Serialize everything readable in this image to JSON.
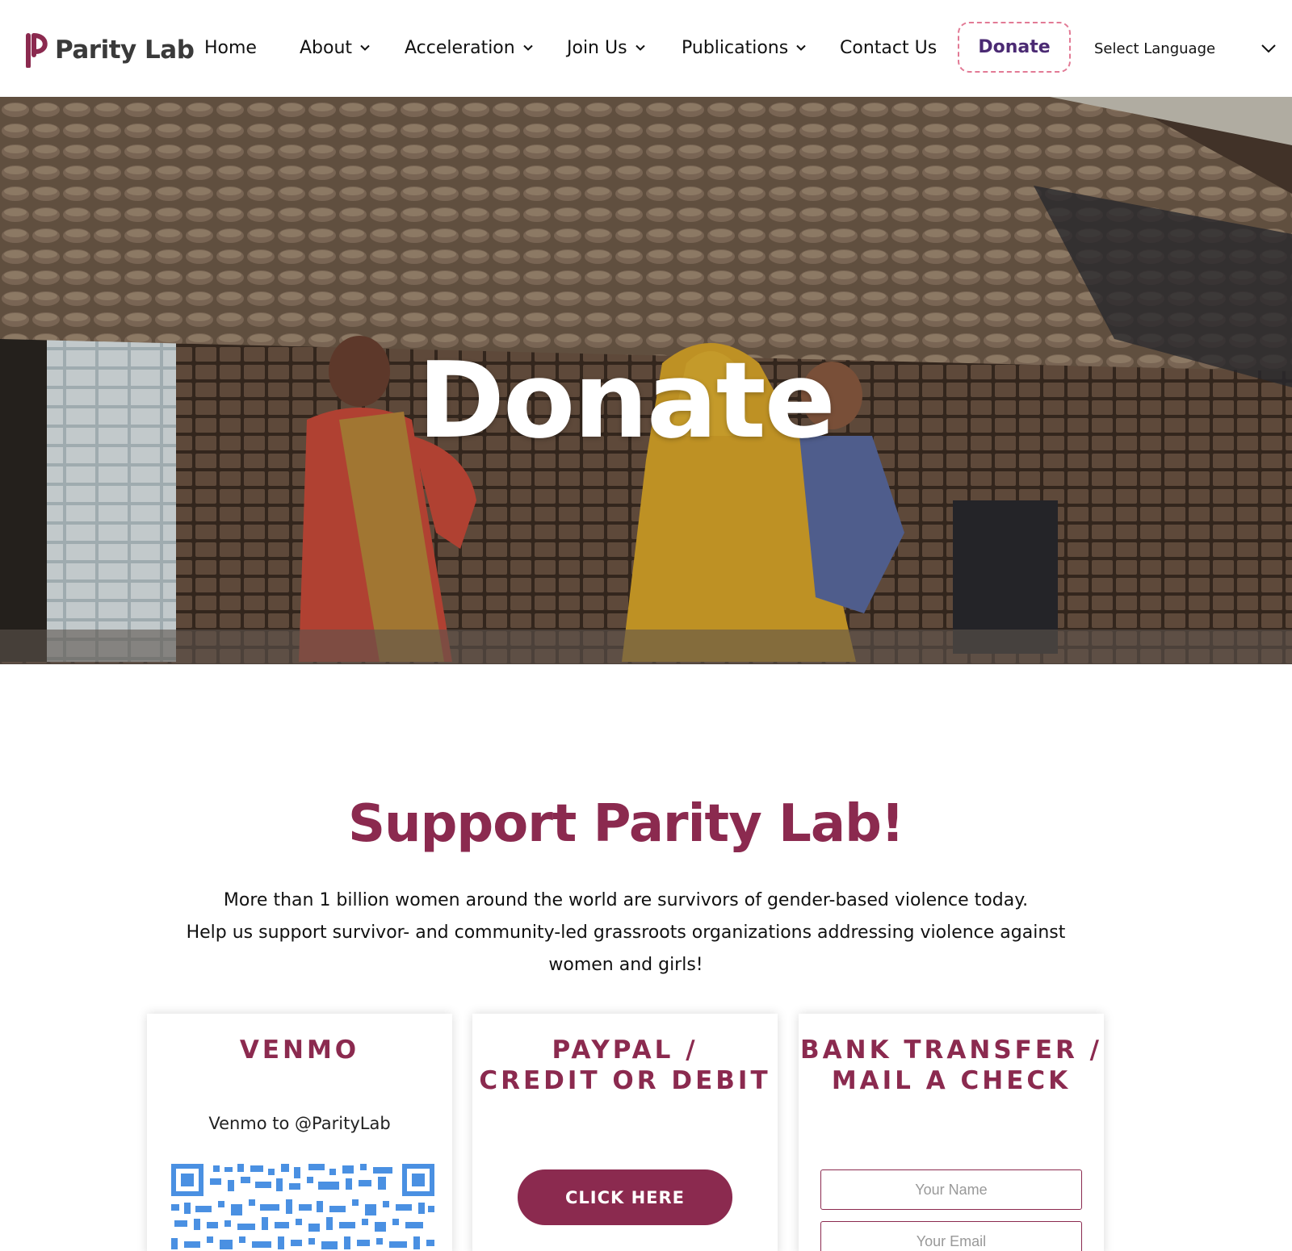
{
  "header": {
    "logo_text": "Parity Lab",
    "nav": [
      {
        "label": "Home",
        "has_dropdown": false
      },
      {
        "label": "About",
        "has_dropdown": true
      },
      {
        "label": "Acceleration",
        "has_dropdown": true
      },
      {
        "label": "Join Us",
        "has_dropdown": true
      },
      {
        "label": "Publications",
        "has_dropdown": true
      },
      {
        "label": "Contact Us",
        "has_dropdown": false
      }
    ],
    "donate_label": "Donate",
    "language_label": "Select Language"
  },
  "hero": {
    "title": "Donate"
  },
  "support": {
    "title": "Support Parity Lab!",
    "line1": "More than 1 billion women around the world are survivors of gender-based violence today.",
    "line2": "Help us support survivor- and community-led grassroots organizations addressing violence against women and girls!"
  },
  "cards": {
    "venmo": {
      "title": "VENMO",
      "text": "Venmo to @ParityLab"
    },
    "paypal": {
      "title_line1": "PAYPAL /",
      "title_line2": "CREDIT OR DEBIT",
      "button": "CLICK HERE"
    },
    "bank": {
      "title_line1": "BANK TRANSFER /",
      "title_line2": "MAIL A CHECK",
      "name_placeholder": "Your Name",
      "email_placeholder": "Your Email"
    }
  },
  "colors": {
    "brand": "#8b2a4f",
    "donate_text": "#4b2a73",
    "donate_border": "#e27a95",
    "qr": "#4a90e2"
  }
}
